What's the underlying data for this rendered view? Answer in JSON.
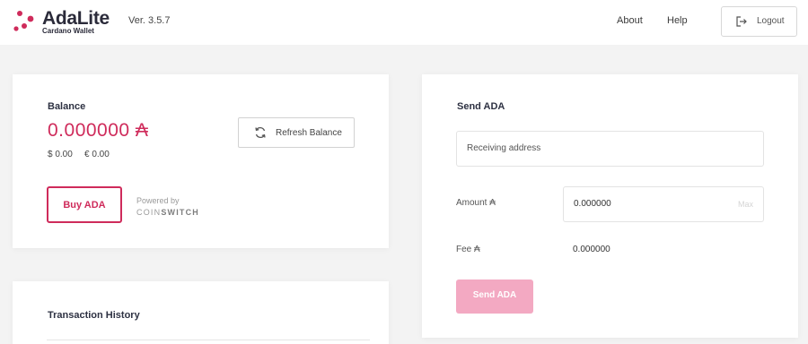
{
  "header": {
    "brand_name": "AdaLite",
    "brand_subtitle": "Cardano Wallet",
    "version": "Ver. 3.5.7",
    "nav": {
      "about": "About",
      "help": "Help",
      "logout": "Logout"
    }
  },
  "balance_card": {
    "title": "Balance",
    "amount": "0.000000 ₳",
    "usd": "$ 0.00",
    "eur": "€ 0.00",
    "refresh_label": "Refresh Balance",
    "buy_label": "Buy ADA",
    "powered_by": "Powered by",
    "partner_light": "COIN",
    "partner_bold": "SWITCH"
  },
  "transaction_history": {
    "title": "Transaction History"
  },
  "send_card": {
    "title": "Send ADA",
    "address_placeholder": "Receiving address",
    "amount_label": "Amount ₳",
    "amount_value": "0.000000",
    "max_label": "Max",
    "fee_label": "Fee ₳",
    "fee_value": "0.000000",
    "send_label": "Send ADA"
  },
  "colors": {
    "accent": "#cf2b5b",
    "send_button_disabled": "#f3a9c2",
    "page_background": "#f3f3f3"
  }
}
